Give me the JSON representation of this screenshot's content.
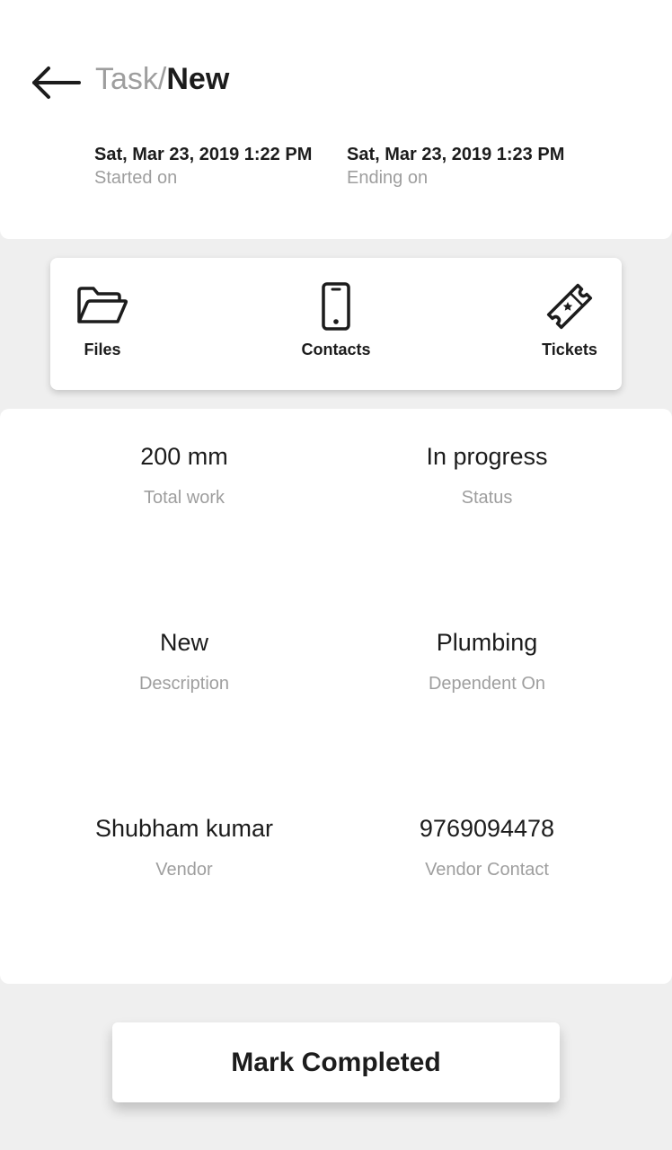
{
  "header": {
    "breadcrumb_parent": "Task/",
    "breadcrumb_current": "New",
    "started": {
      "value": "Sat, Mar 23, 2019 1:22 PM",
      "label": "Started on"
    },
    "ending": {
      "value": "Sat, Mar 23, 2019 1:23 PM",
      "label": "Ending on"
    }
  },
  "actions": {
    "files": {
      "label": "Files",
      "icon": "folder-open-icon"
    },
    "contacts": {
      "label": "Contacts",
      "icon": "phone-icon"
    },
    "tickets": {
      "label": "Tickets",
      "icon": "ticket-icon"
    }
  },
  "details": {
    "total_work": {
      "value": "200 mm",
      "label": "Total work"
    },
    "status": {
      "value": "In progress",
      "label": "Status"
    },
    "description": {
      "value": "New",
      "label": "Description"
    },
    "dependent_on": {
      "value": "Plumbing",
      "label": "Dependent On"
    },
    "vendor": {
      "value": "Shubham kumar",
      "label": "Vendor"
    },
    "vendor_contact": {
      "value": "9769094478",
      "label": "Vendor Contact"
    }
  },
  "footer": {
    "mark_completed_label": "Mark Completed"
  },
  "colors": {
    "background": "#efefef",
    "card": "#ffffff",
    "text": "#1c1c1c",
    "muted": "#9e9e9e"
  }
}
